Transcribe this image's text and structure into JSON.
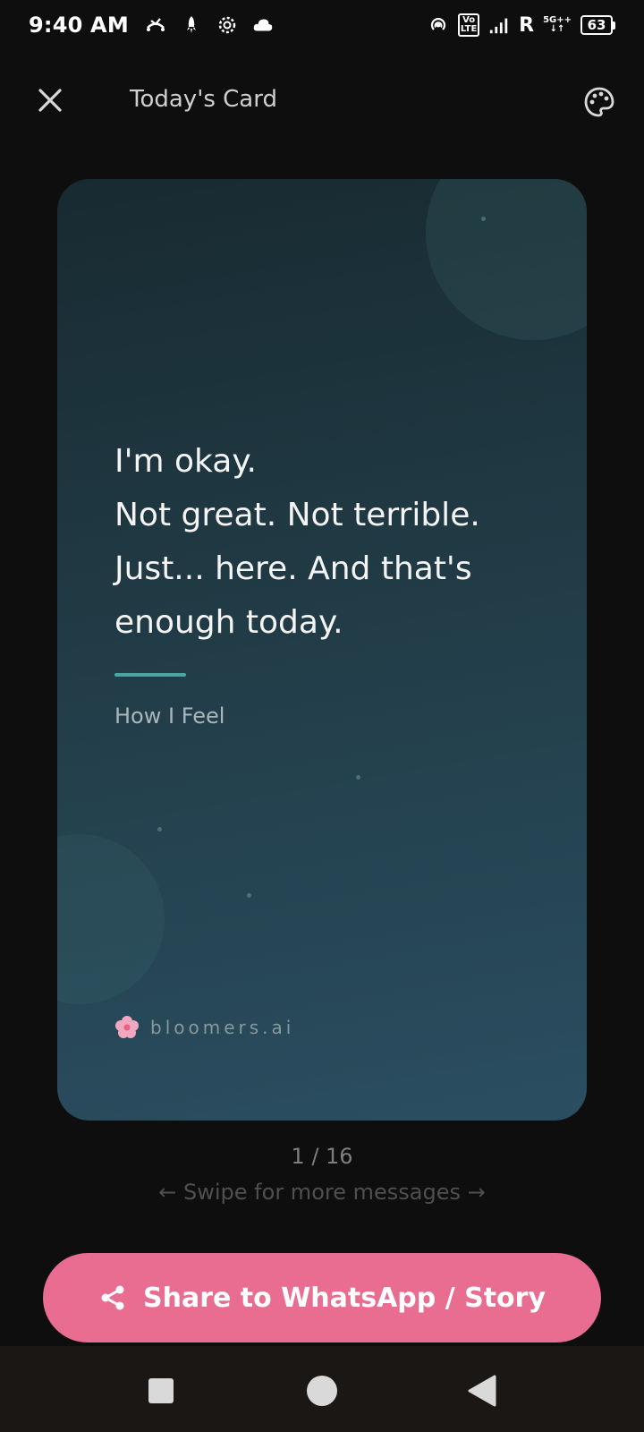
{
  "status_bar": {
    "time": "9:40 AM",
    "volte_top": "Vo",
    "volte_bottom": "LTE",
    "roaming": "R",
    "network_type": "5G++",
    "battery": "63"
  },
  "header": {
    "title": "Today's Card"
  },
  "card": {
    "message": "I'm okay.\nNot great. Not terrible.\nJust... here. And that's\nenough today.",
    "category": "How I Feel",
    "brand": "bloomers.ai"
  },
  "pager": {
    "position": "1 / 16",
    "hint": "← Swipe for more messages →"
  },
  "share": {
    "label": "Share to WhatsApp / Story"
  },
  "colors": {
    "accent": "#e96c91",
    "divider": "#4fa3a0",
    "background": "#0e0e0e"
  }
}
